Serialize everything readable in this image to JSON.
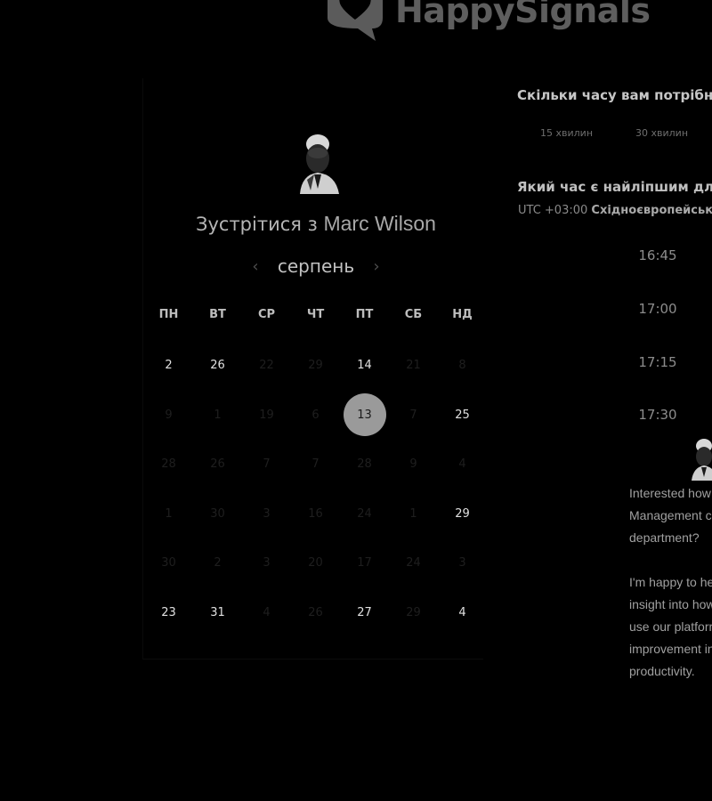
{
  "brand": {
    "name": "HappySignals",
    "color": "#5e5e5e"
  },
  "header": {
    "meet_prefix": "Зустрітися з",
    "host_name": "Marc Wilson"
  },
  "calendar": {
    "month": "серпень",
    "weekdays": [
      "ПН",
      "ВТ",
      "СР",
      "ЧТ",
      "ПТ",
      "СБ",
      "НД"
    ],
    "weeks": [
      [
        {
          "d": "2",
          "state": "active"
        },
        {
          "d": "26",
          "state": "active"
        },
        {
          "d": "22",
          "state": "inactive"
        },
        {
          "d": "29",
          "state": "inactive"
        },
        {
          "d": "14",
          "state": "active"
        },
        {
          "d": "21",
          "state": "inactive"
        },
        {
          "d": "8",
          "state": "inactive"
        }
      ],
      [
        {
          "d": "9",
          "state": "inactive"
        },
        {
          "d": "1",
          "state": "inactive"
        },
        {
          "d": "19",
          "state": "inactive"
        },
        {
          "d": "6",
          "state": "inactive"
        },
        {
          "d": "13",
          "state": "selected"
        },
        {
          "d": "7",
          "state": "inactive"
        },
        {
          "d": "25",
          "state": "active"
        }
      ],
      [
        {
          "d": "28",
          "state": "inactive"
        },
        {
          "d": "26",
          "state": "inactive"
        },
        {
          "d": "7",
          "state": "inactive"
        },
        {
          "d": "7",
          "state": "inactive"
        },
        {
          "d": "28",
          "state": "inactive"
        },
        {
          "d": "9",
          "state": "inactive"
        },
        {
          "d": "4",
          "state": "inactive"
        }
      ],
      [
        {
          "d": "1",
          "state": "inactive"
        },
        {
          "d": "30",
          "state": "inactive"
        },
        {
          "d": "3",
          "state": "inactive"
        },
        {
          "d": "16",
          "state": "inactive"
        },
        {
          "d": "24",
          "state": "inactive"
        },
        {
          "d": "1",
          "state": "inactive"
        },
        {
          "d": "29",
          "state": "active"
        }
      ],
      [
        {
          "d": "30",
          "state": "inactive"
        },
        {
          "d": "2",
          "state": "inactive"
        },
        {
          "d": "3",
          "state": "inactive"
        },
        {
          "d": "20",
          "state": "inactive"
        },
        {
          "d": "17",
          "state": "inactive"
        },
        {
          "d": "24",
          "state": "inactive"
        },
        {
          "d": "3",
          "state": "inactive"
        }
      ],
      [
        {
          "d": "23",
          "state": "active"
        },
        {
          "d": "31",
          "state": "active"
        },
        {
          "d": "4",
          "state": "inactive"
        },
        {
          "d": "26",
          "state": "inactive"
        },
        {
          "d": "27",
          "state": "active"
        },
        {
          "d": "29",
          "state": "inactive"
        },
        {
          "d": "4",
          "state": "active"
        }
      ]
    ]
  },
  "duration": {
    "title": "Скільки часу вам потрібно?",
    "options": [
      "15 хвилин",
      "30 хвилин"
    ]
  },
  "time": {
    "title": "Який час є найліпшим для ва",
    "timezone_offset": "UTC +03:00",
    "timezone_name": "Східноєвропейськи",
    "slots": [
      "16:45",
      "17:00",
      "17:15",
      "17:30"
    ]
  },
  "chat": {
    "lines": [
      "Interested how",
      "Management co",
      "department?",
      "",
      "I'm happy to he",
      "insight into how",
      "use our platform",
      "improvement in",
      "productivity."
    ]
  }
}
